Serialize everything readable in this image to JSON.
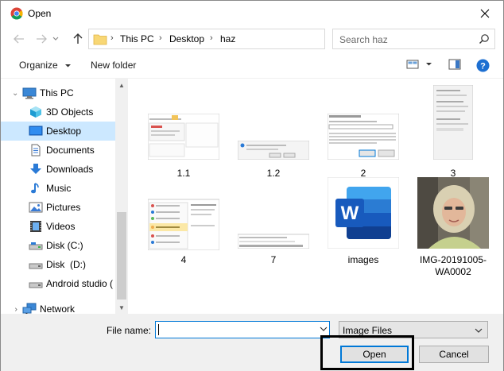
{
  "window": {
    "title": "Open"
  },
  "address": {
    "crumbs": [
      "This PC",
      "Desktop",
      "haz"
    ]
  },
  "search": {
    "placeholder": "Search haz"
  },
  "toolbar": {
    "organize": "Organize",
    "new_folder": "New folder"
  },
  "sidebar": {
    "items": [
      {
        "label": "This PC",
        "icon": "this-pc-icon"
      },
      {
        "label": "3D Objects",
        "icon": "3d-objects-icon"
      },
      {
        "label": "Desktop",
        "icon": "desktop-icon",
        "selected": true
      },
      {
        "label": "Documents",
        "icon": "documents-icon"
      },
      {
        "label": "Downloads",
        "icon": "downloads-icon"
      },
      {
        "label": "Music",
        "icon": "music-icon"
      },
      {
        "label": "Pictures",
        "icon": "pictures-icon"
      },
      {
        "label": "Videos",
        "icon": "videos-icon"
      },
      {
        "label": "Disk (C:)",
        "icon": "drive-icon"
      },
      {
        "label": "Disk  (D:)",
        "icon": "drive-icon"
      },
      {
        "label": "Android studio (",
        "icon": "drive-icon"
      },
      {
        "label": "Network",
        "icon": "network-icon"
      }
    ]
  },
  "files": [
    {
      "name": "1.1",
      "kind": "screenshot"
    },
    {
      "name": "1.2",
      "kind": "screenshot"
    },
    {
      "name": "2",
      "kind": "screenshot"
    },
    {
      "name": "3",
      "kind": "screenshot"
    },
    {
      "name": "4",
      "kind": "screenshot"
    },
    {
      "name": "7",
      "kind": "screenshot"
    },
    {
      "name": "images",
      "kind": "word-document"
    },
    {
      "name": "IMG-20191005-WA0002",
      "kind": "photo"
    }
  ],
  "bottom": {
    "file_name_label": "File name:",
    "file_name_value": "",
    "file_type": "Image Files",
    "open_label": "Open",
    "cancel_label": "Cancel"
  },
  "colors": {
    "selection": "#cce8ff",
    "accent": "#0078d7",
    "word_blue": "#185abd"
  }
}
